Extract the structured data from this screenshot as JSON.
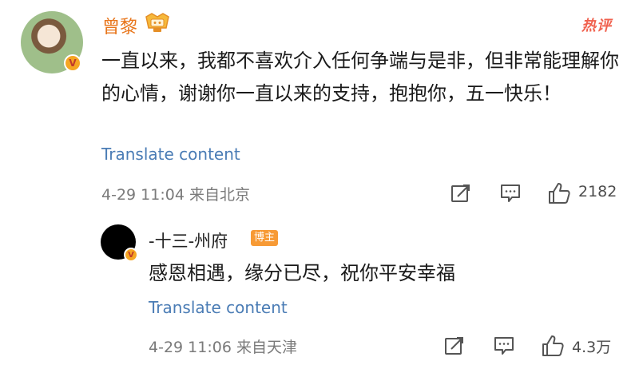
{
  "comment": {
    "author": "曾黎",
    "hot_label": "热评",
    "text": "一直以来，我都不喜欢介入任何争端与是非，但非常能理解你的心情，谢谢你一直以来的支持，抱抱你，五一快乐！",
    "translate": "Translate content",
    "meta": "4-29 11:04  来自北京",
    "like_count": "2182"
  },
  "reply": {
    "author": "-十三-州府",
    "badge": "博主",
    "text": "感恩相遇，缘分已尽，祝你平安幸福",
    "translate": "Translate content",
    "meta": "4-29 11:06  来自天津",
    "like_count": "4.3万"
  },
  "icons": [
    "repost-icon",
    "comment-icon",
    "like-icon",
    "verified-badge-icon",
    "medal-icon"
  ],
  "colors": {
    "author": "#e8761c",
    "link": "#4a7cb5",
    "hot": "#f0624f",
    "badge": "#f79a35"
  }
}
